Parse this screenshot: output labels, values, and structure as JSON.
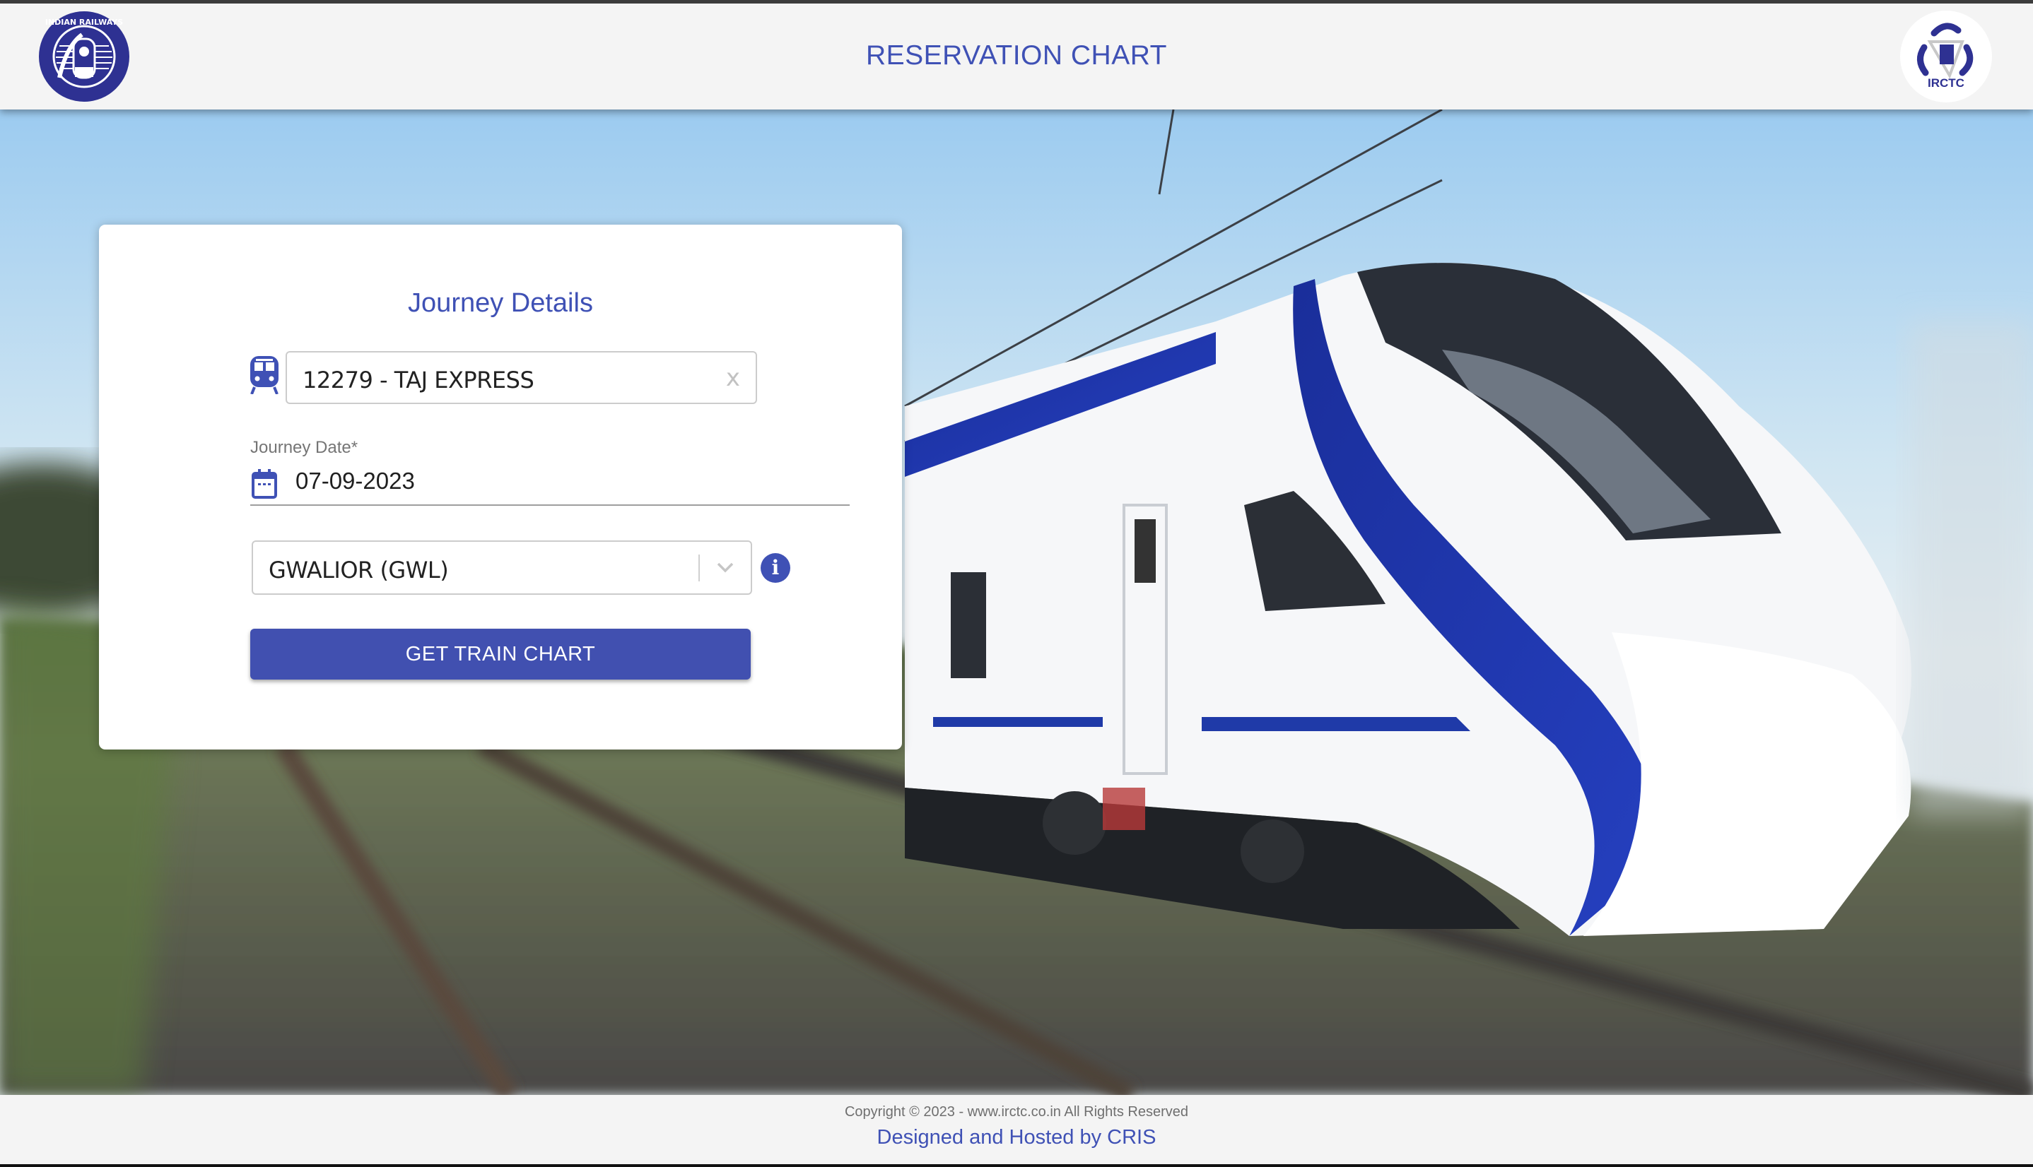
{
  "header": {
    "title": "RESERVATION CHART",
    "left_logo": "indian-railways-logo",
    "left_logo_text": "INDIAN RAILWAYS",
    "right_logo": "irctc-logo",
    "right_logo_text": "IRCTC"
  },
  "form": {
    "title": "Journey Details",
    "train": {
      "icon": "train-icon",
      "value": "12279 - TAJ EXPRESS",
      "clear_label": "x"
    },
    "journey_date": {
      "label": "Journey Date*",
      "icon": "calendar-icon",
      "value": "07-09-2023"
    },
    "station": {
      "value": "GWALIOR (GWL)",
      "info_label": "i"
    },
    "submit_label": "GET TRAIN CHART"
  },
  "footer": {
    "copyright": "Copyright © 2023 - www.irctc.co.in All Rights Reserved",
    "credit": "Designed and Hosted by CRIS"
  },
  "colors": {
    "primary": "#3f51b5",
    "button": "#4150b0",
    "header_bg": "#f4f4f4"
  }
}
